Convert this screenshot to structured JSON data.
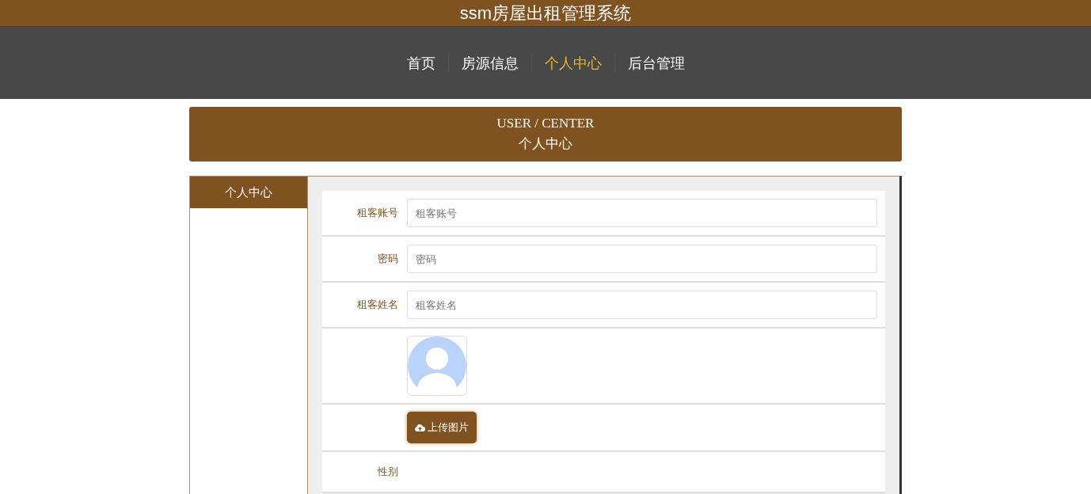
{
  "site_title": "ssm房屋出租管理系统",
  "nav": [
    {
      "label": "首页",
      "selected": false
    },
    {
      "label": "房源信息",
      "selected": false
    },
    {
      "label": "个人中心",
      "selected": true
    },
    {
      "label": "后台管理",
      "selected": false
    }
  ],
  "banner": {
    "english": "USER / CENTER",
    "title": "个人中心"
  },
  "sidebar": {
    "header": "个人中心"
  },
  "form_rows": [
    {
      "kind": "input",
      "label": "租客账号",
      "placeholder": "租客账号"
    },
    {
      "kind": "input",
      "label": "密码",
      "placeholder": "密码"
    },
    {
      "kind": "input",
      "label": "租客姓名",
      "placeholder": "租客姓名"
    },
    {
      "kind": "avatar"
    },
    {
      "kind": "upload",
      "button": "上传图片"
    },
    {
      "kind": "label",
      "label": "性别"
    }
  ]
}
